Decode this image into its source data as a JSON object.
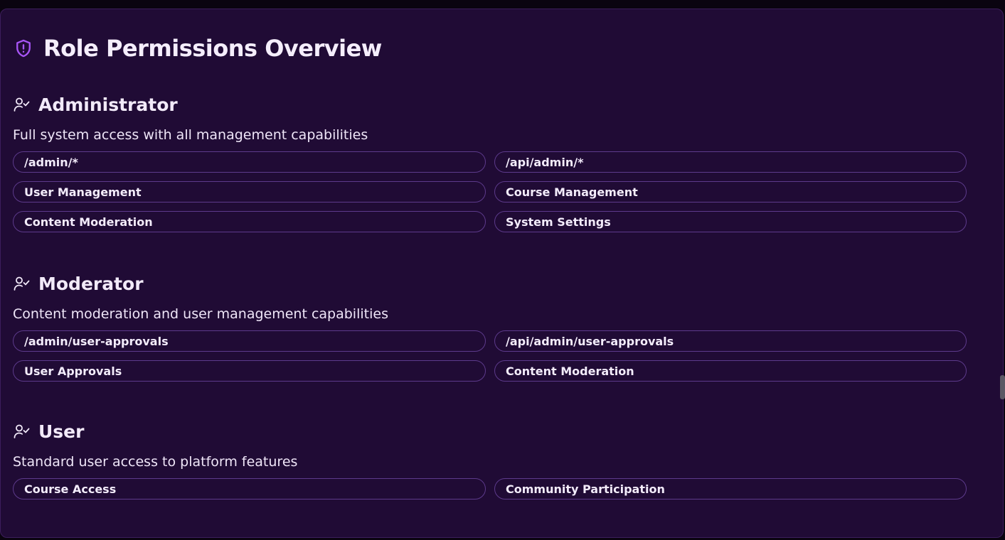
{
  "page": {
    "title": "Role Permissions Overview",
    "title_icon": "shield-alert-icon",
    "accent_color": "#a855f7"
  },
  "roles": [
    {
      "name": "Administrator",
      "icon": "user-check-icon",
      "description": "Full system access with all management capabilities",
      "permissions": [
        "/admin/*",
        "/api/admin/*",
        "User Management",
        "Course Management",
        "Content Moderation",
        "System Settings"
      ]
    },
    {
      "name": "Moderator",
      "icon": "user-check-icon",
      "description": "Content moderation and user management capabilities",
      "permissions": [
        "/admin/user-approvals",
        "/api/admin/user-approvals",
        "User Approvals",
        "Content Moderation"
      ]
    },
    {
      "name": "User",
      "icon": "user-check-icon",
      "description": "Standard user access to platform features",
      "permissions": [
        "Course Access",
        "Community Participation"
      ]
    }
  ]
}
